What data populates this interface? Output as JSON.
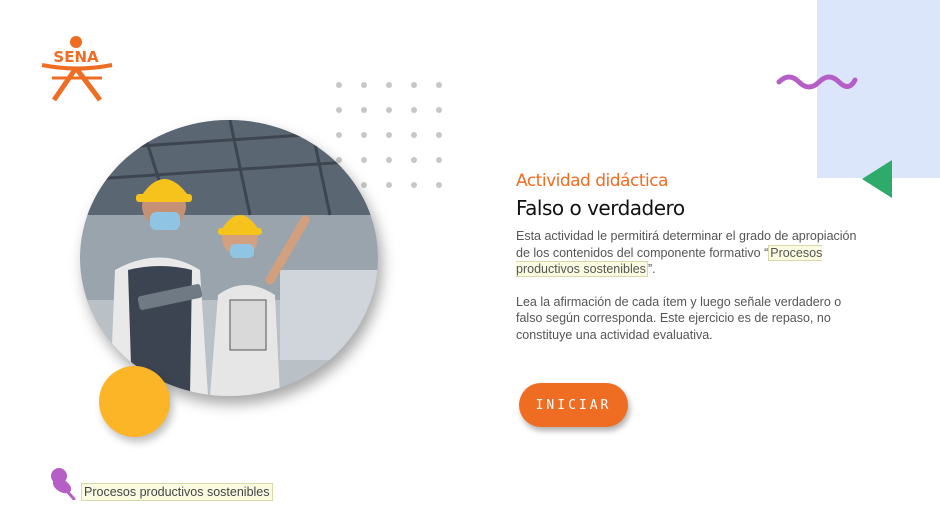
{
  "brand": {
    "logo_text": "SENA",
    "logo_color": "#ef6c23"
  },
  "decorations": {
    "blue_panel_color": "#dbe6fb",
    "squiggle_color": "#b55fc6",
    "triangle_color": "#2eaa6a",
    "circle_color": "#fbb527",
    "dots_color": "#c7c7c7"
  },
  "activity": {
    "subtitle": "Actividad didáctica",
    "title": "Falso o verdadero",
    "description_prefix": "Esta actividad le permitirá determinar el grado de apropiación de los contenidos del componente formativo “",
    "description_highlight": "Procesos productivos sostenibles",
    "description_suffix": "”.",
    "instructions": "Lea la afirmación de cada ítem y luego señale verdadero o falso según corresponda.  Este ejercicio es de repaso, no constituye una actividad evaluativa."
  },
  "start_button": {
    "label": "INICIAR",
    "color": "#ef6c23"
  },
  "footer": {
    "label": "Procesos productivos sostenibles",
    "icon": "pushpin-icon"
  }
}
